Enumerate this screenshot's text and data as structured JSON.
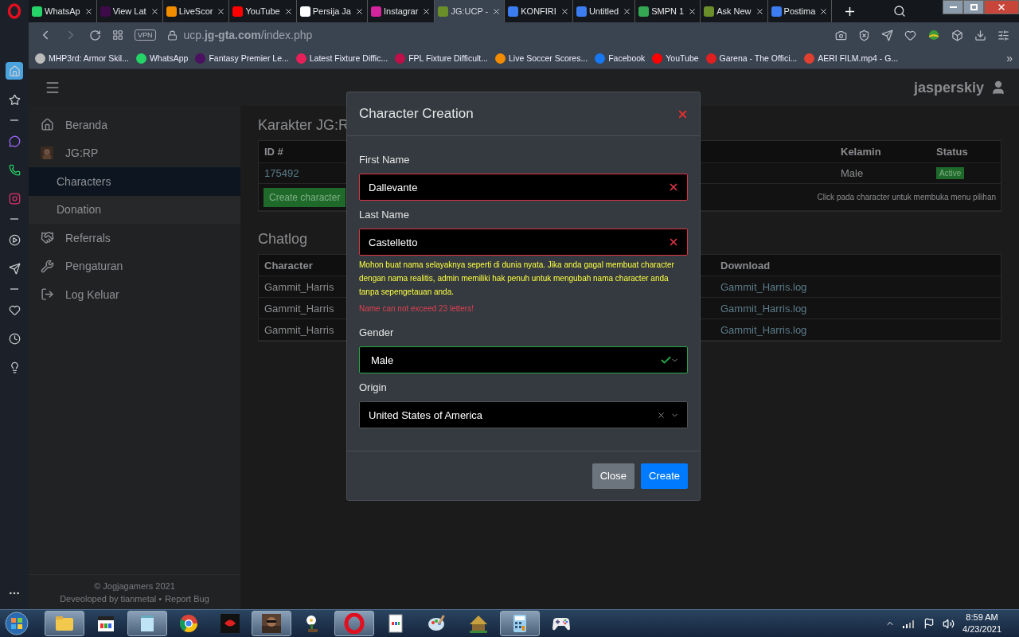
{
  "browser": {
    "tabs": [
      {
        "label": "WhatsAp",
        "color": "#25d366",
        "selected": false
      },
      {
        "label": "View Lat",
        "color": "#3d0a4a",
        "selected": false
      },
      {
        "label": "LiveScor",
        "color": "#f28c00",
        "selected": false
      },
      {
        "label": "YouTube",
        "color": "#ff0000",
        "selected": false
      },
      {
        "label": "Persija Ja",
        "color": "#ffffff",
        "selected": false
      },
      {
        "label": "Instagrar",
        "color": "#d6249f",
        "selected": false
      },
      {
        "label": "JG:UCP -",
        "color": "#6a8f2a",
        "selected": true
      },
      {
        "label": "KONFIRI",
        "color": "#3b7cf0",
        "selected": false
      },
      {
        "label": "Untitled",
        "color": "#3b7cf0",
        "selected": false
      },
      {
        "label": "SMPN 1",
        "color": "#34a853",
        "selected": false
      },
      {
        "label": "Ask New",
        "color": "#6a8f2a",
        "selected": false
      },
      {
        "label": "Postima",
        "color": "#3b7cf0",
        "selected": false
      }
    ],
    "vpn": "VPN",
    "url": "ucp.**jg-gta.com**/index.php",
    "bookmarks": [
      {
        "label": "MHP3rd: Armor Skil...",
        "color": "#bbbbbb"
      },
      {
        "label": "WhatsApp",
        "color": "#25d366"
      },
      {
        "label": "Fantasy Premier Le...",
        "color": "#4b1060"
      },
      {
        "label": "Latest Fixture Diffic...",
        "color": "#e8205a"
      },
      {
        "label": "FPL Fixture Difficult...",
        "color": "#c0104a"
      },
      {
        "label": "Live Soccer Scores...",
        "color": "#f28c00"
      },
      {
        "label": "Facebook",
        "color": "#1877f2"
      },
      {
        "label": "YouTube",
        "color": "#ff0000"
      },
      {
        "label": "Garena - The Offici...",
        "color": "#e02020"
      },
      {
        "label": "AERI FILM.mp4 - G...",
        "color": "#e04030"
      }
    ],
    "bookmarks_more": "»"
  },
  "opera_sidebar": [
    {
      "kind": "home",
      "selected": true
    },
    {
      "kind": "star",
      "selected": false
    },
    {
      "kind": "divider"
    },
    {
      "kind": "messenger",
      "selected": false
    },
    {
      "kind": "whatsapp",
      "selected": false
    },
    {
      "kind": "instagram",
      "selected": false
    },
    {
      "kind": "divider"
    },
    {
      "kind": "player",
      "selected": false
    },
    {
      "kind": "send",
      "selected": false
    },
    {
      "kind": "divider"
    },
    {
      "kind": "heart",
      "selected": false
    },
    {
      "kind": "history",
      "selected": false
    },
    {
      "kind": "bulb",
      "selected": false
    }
  ],
  "page": {
    "user": "jasperskiy",
    "nav": [
      {
        "kind": "home",
        "label": "Beranda",
        "selected": false
      },
      {
        "kind": "avatar",
        "label": "JG:RP",
        "selected": false,
        "children": [
          {
            "label": "Characters",
            "selected": true
          },
          {
            "label": "Donation",
            "selected": false
          }
        ]
      },
      {
        "kind": "handshake",
        "label": "Referrals",
        "selected": false
      },
      {
        "kind": "tools",
        "label": "Pengaturan",
        "selected": false
      },
      {
        "kind": "logout",
        "label": "Log Keluar",
        "selected": false
      }
    ],
    "footer": {
      "copyright": "© Jogjagamers 2021",
      "credit": "Deveoloped by tianmetal •",
      "link": "Report Bug"
    }
  },
  "characters": {
    "title": "Karakter JG:R",
    "columns": [
      "ID #",
      "Kelamin",
      "Status"
    ],
    "rows": [
      {
        "id": "175492",
        "gender": "Male",
        "status": "Active"
      }
    ],
    "create_button": "Create character",
    "hint": "Click pada character untuk membuka menu pilihan"
  },
  "chatlog": {
    "title": "Chatlog",
    "columns": [
      "Character",
      "Download"
    ],
    "rows": [
      {
        "character": "Gammit_Harris",
        "download": "Gammit_Harris.log"
      },
      {
        "character": "Gammit_Harris",
        "download": "Gammit_Harris.log"
      },
      {
        "character": "Gammit_Harris",
        "download": "Gammit_Harris.log"
      }
    ]
  },
  "modal": {
    "title": "Character Creation",
    "fields": [
      {
        "kind": "text",
        "label": "First Name",
        "value": "Dallevante",
        "invalid": true,
        "valid": false
      },
      {
        "kind": "text",
        "label": "Last Name",
        "value": "Castelletto",
        "invalid": true,
        "valid": false,
        "notes": [
          {
            "kind": "warning",
            "text": "Mohon buat nama selayaknya seperti di dunia nyata. Jika anda gagal membuat character dengan nama realitis, admin memiliki hak penuh untuk mengubah nama character anda tanpa sepengetauan anda."
          },
          {
            "kind": "error",
            "text": "Name can not exceed 23 letters!"
          }
        ]
      },
      {
        "kind": "select",
        "label": "Gender",
        "value": "Male",
        "invalid": false,
        "valid": true
      },
      {
        "kind": "select",
        "label": "Origin",
        "value": "United States of America",
        "invalid": false,
        "valid": false,
        "clearable": true
      }
    ],
    "buttons": [
      {
        "kind": "secondary",
        "label": "Close"
      },
      {
        "kind": "primary",
        "label": "Create"
      }
    ]
  },
  "taskbar": {
    "apps": [
      {
        "kind": "folder",
        "active": true
      },
      {
        "kind": "media",
        "active": false
      },
      {
        "kind": "notepad",
        "active": true
      },
      {
        "kind": "chrome",
        "active": false
      },
      {
        "kind": "garena",
        "active": false
      },
      {
        "kind": "picture",
        "active": true
      },
      {
        "kind": "flower",
        "active": false
      },
      {
        "kind": "opera",
        "active": true
      },
      {
        "kind": "document",
        "active": false
      },
      {
        "kind": "paint",
        "active": false
      },
      {
        "kind": "hut",
        "active": false
      },
      {
        "kind": "calculator",
        "active": true
      },
      {
        "kind": "gamepad",
        "active": false
      }
    ],
    "time": "8:59 AM",
    "date": "4/23/2021"
  }
}
